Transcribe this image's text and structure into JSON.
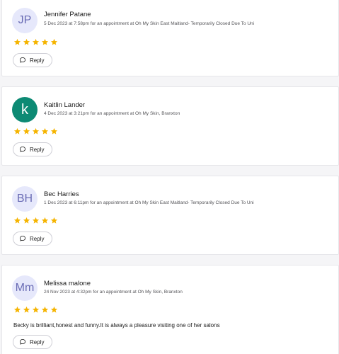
{
  "colors": {
    "star": "#f5b400",
    "avatar_light_bg": "#e6e8fb",
    "avatar_light_fg": "#6a6cb5",
    "avatar_teal_bg": "#0d8a74",
    "accent": "#6f3dff"
  },
  "reviews": [
    {
      "initials": "JP",
      "avatar_style": "light",
      "name": "Jennifer Patane",
      "meta": "5 Dec 2023 at 7:58pm for an appointment at Oh My Skin East Maitland- Temporarily Closed Due To Uni",
      "rating": 5,
      "text": "",
      "reply_label": "Reply"
    },
    {
      "initials": "k",
      "avatar_style": "teal",
      "name": "Kaitlin Lander",
      "meta": "4 Dec 2023 at 3:21pm for an appointment at Oh My Skin, Branxton",
      "rating": 5,
      "text": "",
      "reply_label": "Reply"
    },
    {
      "initials": "BH",
      "avatar_style": "light",
      "name": "Bec Harries",
      "meta": "1 Dec 2023 at 6:11pm for an appointment at Oh My Skin East Maitland- Temporarily Closed Due To Uni",
      "rating": 5,
      "text": "",
      "reply_label": "Reply"
    },
    {
      "initials": "Mm",
      "avatar_style": "light",
      "name": "Melissa malone",
      "meta": "24 Nov 2023 at 4:32pm for an appointment at Oh My Skin, Branxton",
      "rating": 5,
      "text": "Becky is brilliant,honest and funny.It is always a pleasure visiting one of her salons",
      "reply_label": "Reply"
    }
  ]
}
